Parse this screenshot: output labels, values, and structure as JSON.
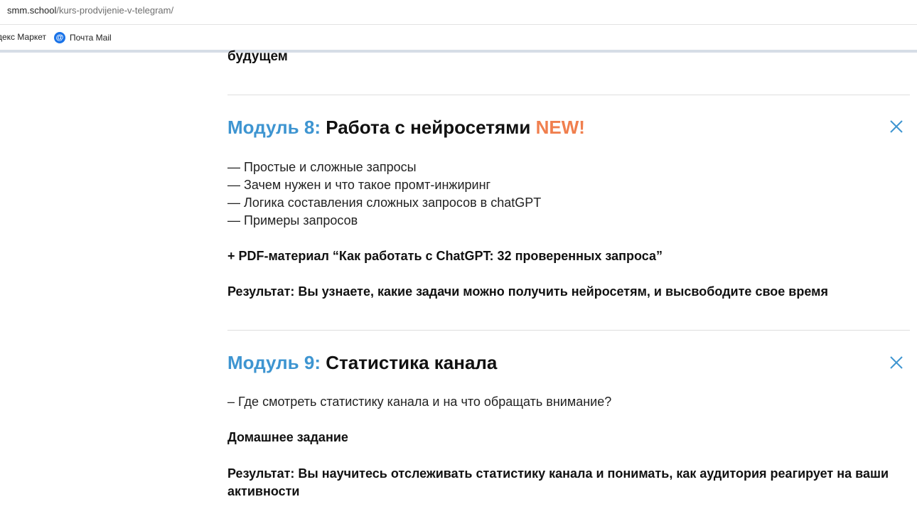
{
  "browser": {
    "url_host": "smm.school",
    "url_path": "/kurs-prodvijenie-v-telegram/",
    "bookmarks": [
      {
        "label": "декс Маркет"
      },
      {
        "label": "Почта Mail",
        "icon": "mail-at-icon"
      }
    ]
  },
  "page": {
    "cut_text": "будущем",
    "modules": [
      {
        "number_label": "Модуль 8:",
        "name": "Работа с нейросетями",
        "badge": "NEW!",
        "bullets": [
          "— Простые и сложные запросы",
          "— Зачем нужен и что такое промт-инжиринг",
          "— Логика составления сложных запросов в chatGPT",
          "— Примеры запросов"
        ],
        "bonus": "+ PDF-материал “Как работать с ChatGPT: 32 проверенных запроса”",
        "result": "Результат: Вы узнаете, какие задачи можно получить нейросетям, и высвободите свое время"
      },
      {
        "number_label": "Модуль 9:",
        "name": "Статистика канала",
        "bullets": [
          "– Где смотреть статистику канала и на что обращать внимание?"
        ],
        "homework": "Домашнее задание",
        "result": "Результат: Вы научитесь отслеживать статистику канала и понимать, как аудитория реагирует на ваши активности"
      }
    ]
  },
  "colors": {
    "module_number": "#3e95d1",
    "new_badge": "#f07f4e",
    "close_icon": "#3e95d1"
  }
}
